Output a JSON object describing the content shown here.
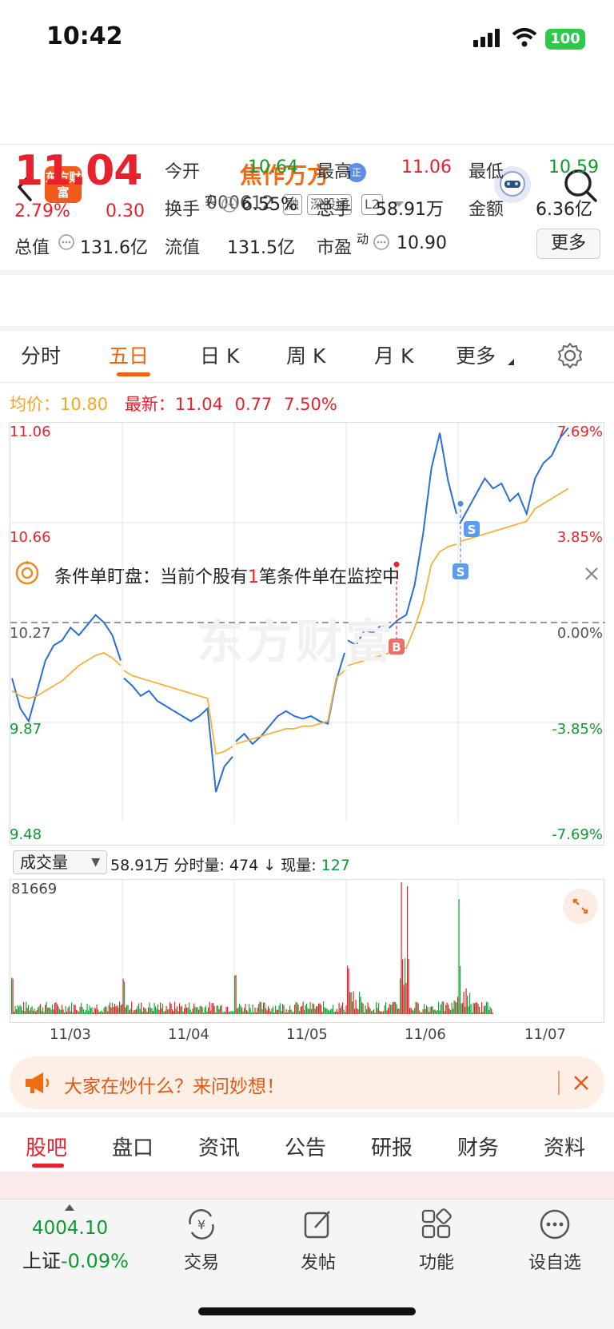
{
  "status": {
    "time": "10:42",
    "battery": "100"
  },
  "header": {
    "logo_text": "东方财富",
    "stock_name": "焦作万方",
    "name_badge": "正",
    "stock_code": "000612",
    "tags": [
      "融",
      "深股通",
      "L2"
    ]
  },
  "quote": {
    "price": "11.04",
    "change_pct": "2.79%",
    "change": "0.30",
    "open_label": "今开",
    "open": "10.64",
    "high_label": "最高",
    "high": "11.06",
    "low_label": "最低",
    "low": "10.59",
    "turnover_label": "换手",
    "turnover_sup": "实",
    "turnover": "6.55%",
    "volume_label": "总手",
    "volume": "58.91万",
    "amount_label": "金额",
    "amount": "6.36亿",
    "mktcap_label": "总值",
    "mktcap": "131.6亿",
    "float_label": "流值",
    "float": "131.5亿",
    "pe_label": "市盈",
    "pe_sup": "动",
    "pe": "10.90",
    "more_label": "更多"
  },
  "notice": {
    "prefix": "条件单盯盘：当前个股有",
    "count": "1",
    "suffix": "笔条件单在监控中"
  },
  "chart_tabs": [
    "分时",
    "五日",
    "日 K",
    "周 K",
    "月 K",
    "更多"
  ],
  "active_chart_tab": "五日",
  "summary": {
    "avg_label": "均价：",
    "avg": "10.80",
    "latest_label": "最新：",
    "latest": "11.04",
    "chg": "0.77",
    "chg_pct": "7.50%"
  },
  "watermark": "东方财富",
  "chart_data": {
    "type": "line",
    "y_ticks_left": [
      "11.06",
      "10.66",
      "10.27",
      "9.87",
      "9.48"
    ],
    "y_ticks_right": [
      "7.69%",
      "3.85%",
      "0.00%",
      "-3.85%",
      "-7.69%"
    ],
    "ylim": [
      9.48,
      11.06
    ],
    "x_labels": [
      "11/03",
      "11/04",
      "11/05",
      "11/06",
      "11/07"
    ],
    "series": [
      {
        "name": "price",
        "color": "#2a6fd6",
        "values": [
          10.05,
          9.93,
          9.88,
          10.0,
          10.12,
          10.18,
          10.2,
          10.25,
          10.22,
          10.26,
          10.3,
          10.27,
          10.22,
          10.12,
          10.05,
          10.02,
          9.98,
          10.0,
          9.96,
          9.94,
          9.92,
          9.9,
          9.88,
          9.9,
          9.93,
          9.6,
          9.7,
          9.74,
          9.8,
          9.83,
          9.79,
          9.82,
          9.86,
          9.9,
          9.92,
          9.9,
          9.89,
          9.9,
          9.88,
          9.87,
          10.04,
          10.15,
          10.2,
          10.18,
          10.24,
          10.23,
          10.26,
          10.25,
          10.28,
          10.3,
          10.42,
          10.62,
          10.88,
          11.02,
          10.83,
          10.7,
          10.66,
          10.72,
          10.78,
          10.84,
          10.8,
          10.82,
          10.75,
          10.78,
          10.7,
          10.84,
          10.9,
          10.93,
          11.0,
          11.04
        ]
      },
      {
        "name": "avg",
        "color": "#f5b13a",
        "values": [
          10.0,
          9.98,
          9.97,
          9.98,
          10.0,
          10.02,
          10.04,
          10.07,
          10.1,
          10.12,
          10.14,
          10.15,
          10.13,
          10.1,
          10.08,
          10.06,
          10.05,
          10.04,
          10.03,
          10.02,
          10.01,
          10.0,
          9.99,
          9.98,
          9.97,
          9.75,
          9.76,
          9.78,
          9.79,
          9.8,
          9.81,
          9.82,
          9.83,
          9.84,
          9.85,
          9.85,
          9.86,
          9.86,
          9.87,
          9.88,
          10.05,
          10.08,
          10.1,
          10.11,
          10.12,
          10.13,
          10.14,
          10.15,
          10.16,
          10.17,
          10.25,
          10.35,
          10.5,
          10.55,
          10.57,
          10.58,
          10.59,
          10.6,
          10.61,
          10.62,
          10.63,
          10.64,
          10.65,
          10.66,
          10.67,
          10.72,
          10.74,
          10.76,
          10.78,
          10.8
        ]
      }
    ],
    "markers": [
      "B",
      "S",
      "S"
    ],
    "volume_panel": {
      "label": "成交量",
      "total": "58.91万",
      "interval_label": "分时量:",
      "interval_value": "474",
      "arrow": "↓",
      "current_label": "现量:",
      "current_value": "127",
      "max": "81669"
    },
    "grid": true
  },
  "banner": {
    "text": "大家在炒什么？来问妙想！"
  },
  "bottom_tabs": [
    "股吧",
    "盘口",
    "资讯",
    "公告",
    "研报",
    "财务",
    "资料"
  ],
  "footer": {
    "index_value": "4004.10",
    "index_name": "上证",
    "index_change": "-0.09%",
    "items": [
      "交易",
      "发帖",
      "功能",
      "设自选"
    ]
  }
}
